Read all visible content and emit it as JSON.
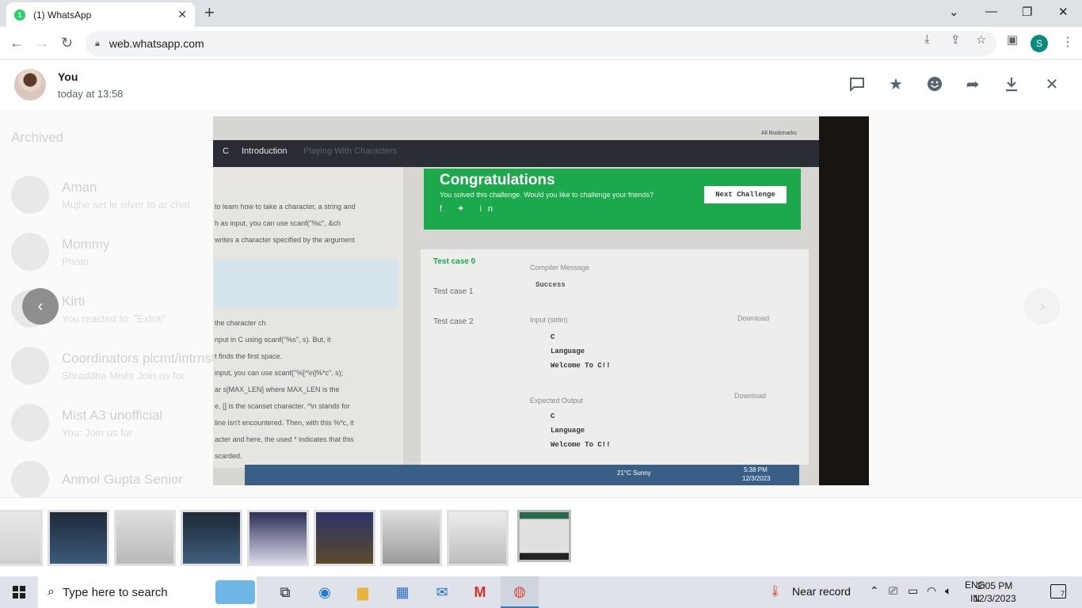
{
  "browser": {
    "tab_title": "(1) WhatsApp",
    "tab_badge": "1",
    "url": "web.whatsapp.com",
    "profile_initial": "S"
  },
  "viewer": {
    "sender": "You",
    "timestamp": "today at 13:58"
  },
  "background_chats": [
    {
      "name": "Archived",
      "msg": ""
    },
    {
      "name": "Aman",
      "msg": "Mujhe set le silver to ar chat"
    },
    {
      "name": "Mommy",
      "msg": "Photo"
    },
    {
      "name": "Kirti",
      "msg": "You reacted to: \"Extra\""
    },
    {
      "name": "Coordinators plcmt/intrnst",
      "msg": "Shraddha Mishr Join us for"
    },
    {
      "name": "Mist A3 unofficial",
      "msg": "You: Join us for"
    },
    {
      "name": "Anmol Gupta Senior",
      "msg": ""
    }
  ],
  "photo_content": {
    "course": "C",
    "section": "Introduction",
    "lesson": "Playing With Characters",
    "bookmarks": "All Bookmarks",
    "congrats_title": "Congratulations",
    "congrats_sub": "You solved this challenge. Would you like to challenge your friends?",
    "next_btn": "Next Challenge",
    "tests": [
      "Test case 0",
      "Test case 1",
      "Test case 2"
    ],
    "compiler_label": "Compiler Message",
    "compiler_msg": "Success",
    "input_label": "Input (stdin)",
    "download": "Download",
    "input_lines": [
      "C",
      "Language",
      "Welcome To C!!"
    ],
    "expected_label": "Expected Output",
    "expected_lines": [
      "C",
      "Language",
      "Welcome To C!!"
    ],
    "lesson_lines": [
      "to learn how to take a character, a string and",
      "h as input, you can use scanf(\"%c\", &ch",
      "writes a character specified by the argument",
      "",
      "",
      "the character ch",
      "nput in C using scanf(\"%s\", s). But, it",
      "t finds the first space.",
      "input, you can use scanf(\"%[^\\n]%*c\", s);",
      "ar s[MAX_LEN] where MAX_LEN is the",
      "e, [] is the scanset character. ^\\n stands for",
      "line isn't encountered. Then, with this %*c, it",
      "acter and here, the used * indicates that this",
      "scarded."
    ],
    "weather": "21°C Sunny",
    "photo_clock": "5:38 PM",
    "photo_date": "12/3/2023"
  },
  "thumbnails_count": 9,
  "taskbar": {
    "search_placeholder": "Type here to search",
    "weather": "Near record",
    "lang_top": "ENG",
    "lang_bottom": "IN",
    "time": "2:05 PM",
    "date": "12/3/2023",
    "notifications": "7"
  }
}
